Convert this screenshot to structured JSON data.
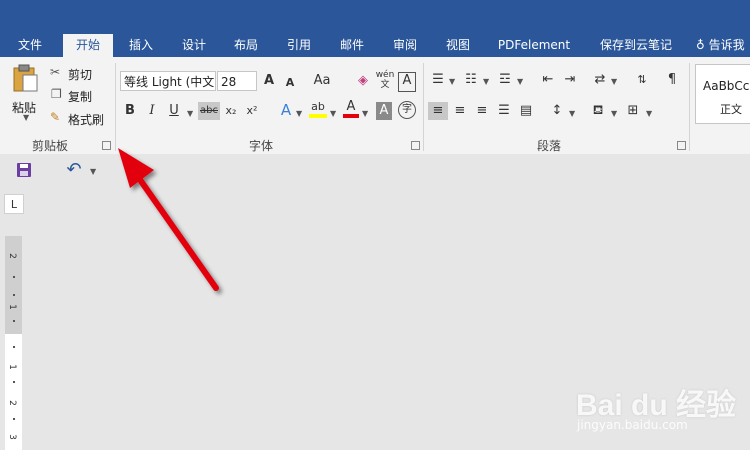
{
  "tabs": [
    "文件",
    "开始",
    "插入",
    "设计",
    "布局",
    "引用",
    "邮件",
    "审阅",
    "视图",
    "PDFelement",
    "保存到云笔记"
  ],
  "tell_me": "告诉我",
  "clipboard": {
    "paste": "粘贴",
    "cut": "剪切",
    "copy": "复制",
    "format_painter": "格式刷",
    "group_label": "剪贴板"
  },
  "font": {
    "font_name": "等线 Light (中文",
    "font_size": "28",
    "group_label": "字体",
    "grow": "A",
    "shrink": "A",
    "change_case": "Aa",
    "bold": "B",
    "italic": "I",
    "underline": "U",
    "strikethrough": "abc",
    "subscript": "x₂",
    "superscript": "x²",
    "text_effects": "A",
    "font_color": "A",
    "char_shading": "A",
    "enclose_char": "字",
    "phonetic": "wén",
    "char_border": "A"
  },
  "paragraph": {
    "group_label": "段落"
  },
  "styles": {
    "preview": "AaBbCcI",
    "normal": "正文"
  },
  "ruler": {
    "corner": "L",
    "numbers": [
      "2",
      "1",
      "1",
      "2",
      "3"
    ]
  },
  "watermark": {
    "main": "Bai du 经验",
    "sub": "jingyan.baidu.com"
  },
  "colors": {
    "title_bar": "#2b579a",
    "ribbon": "#f3f3f3",
    "arrow": "#e3000f",
    "highlight": "#ffff00",
    "font_red": "#e3000f"
  }
}
